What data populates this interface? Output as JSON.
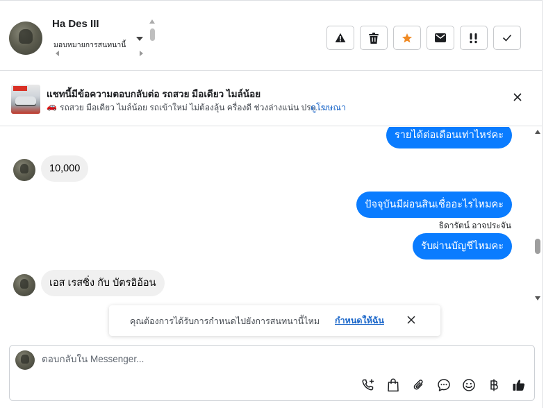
{
  "header": {
    "contact_name": "Ha Des III",
    "assign_label": "มอบหมายการสนทนานี้"
  },
  "actions": [
    {
      "name": "report-spam-button",
      "icon": "warning-icon"
    },
    {
      "name": "delete-button",
      "icon": "trash-icon"
    },
    {
      "name": "star-button",
      "icon": "star-icon",
      "color": "#f08a24"
    },
    {
      "name": "mark-unread-button",
      "icon": "envelope-icon"
    },
    {
      "name": "follow-up-button",
      "icon": "exclamation-icon"
    },
    {
      "name": "mark-done-button",
      "icon": "check-icon"
    }
  ],
  "ad": {
    "title": "แชทนี้มีข้อความตอบกลับต่อ รถสวย มือเดียว ไมล์น้อย",
    "car_emoji": "🚗",
    "description": "รถสวย มือเดียว ไมล์น้อย รถเข้าใหม่ ไม่ต้องลุ้น ครื่องดี ช่วงล่างแน่น ประ...",
    "link_label": "ดูโฆษณา"
  },
  "messages": {
    "out_1": "รายได้ต่อเดือนเท่าไหร่คะ",
    "in_1": "10,000",
    "out_2": "ปัจจุบันมีผ่อนสินเชื่ออะไรไหมคะ",
    "sender_name": "ธิดารัตน์ อาจประจัน",
    "out_3": "รับผ่านบัญชีไหมคะ",
    "in_2": "เอส เรสซิ่ง กับ บัตรอิอ้อน"
  },
  "toast": {
    "text": "คุณต้องการได้รับการกำหนดไปยังการสนทนานี้ไหม",
    "link_label": "กำหนดให้ฉัน"
  },
  "composer": {
    "placeholder": "ตอบกลับใน Messenger..."
  },
  "colors": {
    "accent": "#0a7cff",
    "link": "#1a66c9",
    "star": "#f08a24"
  }
}
